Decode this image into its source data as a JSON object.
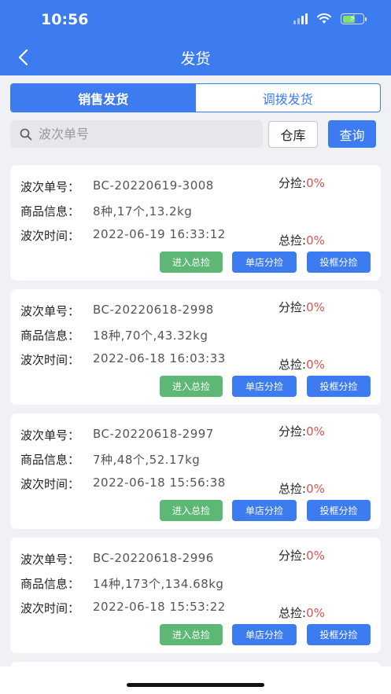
{
  "status_bar": {
    "time": "10:56"
  },
  "nav": {
    "title": "发货"
  },
  "tabs": [
    {
      "label": "销售发货",
      "active": true
    },
    {
      "label": "调拨发货",
      "active": false
    }
  ],
  "search": {
    "placeholder": "波次单号",
    "value": ""
  },
  "buttons": {
    "warehouse": "仓库",
    "query": "查询"
  },
  "labels": {
    "wave_no": "波次单号：",
    "goods_info": "商品信息：",
    "wave_time": "波次时间：",
    "split_pick": "分捡:",
    "total_pick": "总捡:"
  },
  "actions": {
    "enter_total": "进入总捡",
    "store_split": "单店分捡",
    "box_split": "投框分捡"
  },
  "waves": [
    {
      "wave_no": "BC-20220619-3008",
      "goods": "8种,17个,13.2kg",
      "time": "2022-06-19 16:33:12",
      "split_pct": "0%",
      "total_pct": "0%"
    },
    {
      "wave_no": "BC-20220618-2998",
      "goods": "18种,70个,43.32kg",
      "time": "2022-06-18 16:03:33",
      "split_pct": "0%",
      "total_pct": "0%"
    },
    {
      "wave_no": "BC-20220618-2997",
      "goods": "7种,48个,52.17kg",
      "time": "2022-06-18 15:56:38",
      "split_pct": "0%",
      "total_pct": "0%"
    },
    {
      "wave_no": "BC-20220618-2996",
      "goods": "14种,173个,134.68kg",
      "time": "2022-06-18 15:53:22",
      "split_pct": "0%",
      "total_pct": "0%"
    }
  ],
  "colors": {
    "primary": "#3d7bf0",
    "green": "#5cb874",
    "percent": "#d9534f"
  }
}
